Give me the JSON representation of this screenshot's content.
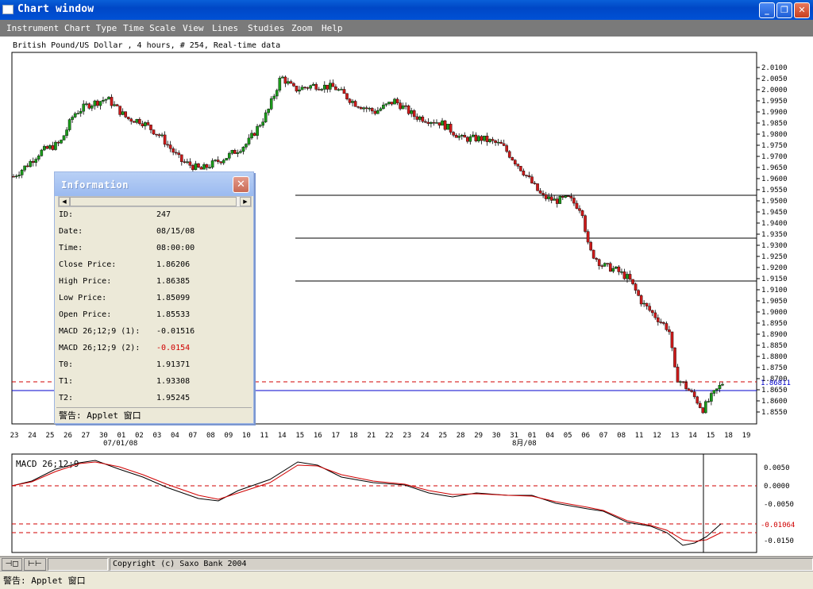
{
  "window": {
    "title": "Chart window",
    "min_label": "_",
    "restore_label": "❐",
    "close_label": "✕"
  },
  "menu": [
    "Instrument",
    "Chart Type",
    "Time Scale",
    "View",
    "Lines",
    "Studies",
    "Zoom",
    "Help"
  ],
  "chart_header": "British Pound/US Dollar , 4 hours, # 254, Real-time data",
  "price_axis": [
    "2.0100",
    "2.0050",
    "2.0000",
    "1.9950",
    "1.9900",
    "1.9850",
    "1.9800",
    "1.9750",
    "1.9700",
    "1.9650",
    "1.9600",
    "1.9550",
    "1.9500",
    "1.9450",
    "1.9400",
    "1.9350",
    "1.9300",
    "1.9250",
    "1.9200",
    "1.9150",
    "1.9100",
    "1.9050",
    "1.9000",
    "1.8950",
    "1.8900",
    "1.8850",
    "1.8800",
    "1.8750",
    "1.8700",
    "1.8650",
    "1.8600",
    "1.8550"
  ],
  "price_marker": {
    "value": "1.86811",
    "color": "#0000cc"
  },
  "date_axis": [
    "23",
    "24",
    "25",
    "26",
    "27",
    "30",
    "01",
    "02",
    "03",
    "04",
    "07",
    "08",
    "09",
    "10",
    "11",
    "14",
    "15",
    "16",
    "17",
    "18",
    "21",
    "22",
    "23",
    "24",
    "25",
    "28",
    "29",
    "30",
    "31",
    "01",
    "04",
    "05",
    "06",
    "07",
    "08",
    "11",
    "12",
    "13",
    "14",
    "15",
    "18",
    "19"
  ],
  "month_labels": [
    "07/01/08",
    "8月/08"
  ],
  "macd": {
    "label": "MACD 26;12;9",
    "axis": [
      "0.0050",
      "0.0000",
      "-0.0050",
      "-0.0100",
      "-0.0150"
    ],
    "marker": {
      "value": "-0.01064",
      "color": "#d00000"
    }
  },
  "info_dialog": {
    "title": "Information",
    "close_label": "✕",
    "rows": [
      {
        "label": "ID:",
        "value": "247"
      },
      {
        "label": "Date:",
        "value": "08/15/08"
      },
      {
        "label": "Time:",
        "value": "08:00:00"
      },
      {
        "label": "Close Price:",
        "value": "1.86206"
      },
      {
        "label": "High Price:",
        "value": "1.86385"
      },
      {
        "label": "Low Price:",
        "value": "1.85099"
      },
      {
        "label": "Open Price:",
        "value": "1.85533"
      },
      {
        "label": "MACD 26;12;9 (1):",
        "value": "-0.01516"
      },
      {
        "label": "MACD 26;12;9 (2):",
        "value": "-0.0154"
      },
      {
        "label": "T0:",
        "value": "1.91371"
      },
      {
        "label": "T1:",
        "value": "1.93308"
      },
      {
        "label": "T2:",
        "value": "1.95245"
      }
    ],
    "footer": "警告: Applet 窗口"
  },
  "statusbar": {
    "copyright": "Copyright (c) Saxo Bank 2004"
  },
  "applet_warning": "警告: Applet 窗口",
  "colors": {
    "titlebar": "#0047c6",
    "bull": "#1a9a1a",
    "bear": "#cc1a1a",
    "macd_line": "#000000",
    "signal_line": "#d00000",
    "hline": "#000000"
  }
}
